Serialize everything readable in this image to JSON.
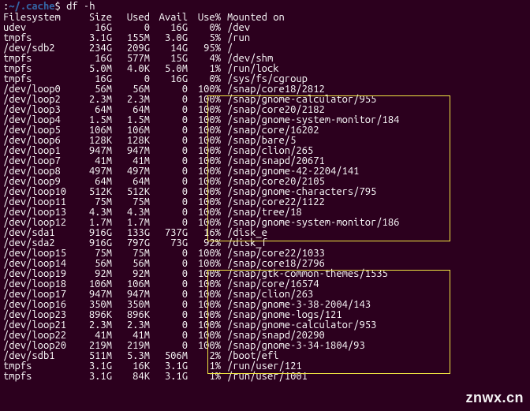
{
  "prompt": {
    "userhost_hidden": "",
    "path": "~/.cache",
    "symbol": "$",
    "command": "df -h"
  },
  "headers": {
    "filesystem": "Filesystem",
    "size": "Size",
    "used": "Used",
    "avail": "Avail",
    "use": "Use%",
    "mounted": "Mounted on"
  },
  "rows": [
    {
      "fs": "udev",
      "size": "16G",
      "used": "0",
      "avail": "16G",
      "use": "0%",
      "mnt": "/dev"
    },
    {
      "fs": "tmpfs",
      "size": "3.1G",
      "used": "155M",
      "avail": "3.0G",
      "use": "5%",
      "mnt": "/run"
    },
    {
      "fs": "/dev/sdb2",
      "size": "234G",
      "used": "209G",
      "avail": "14G",
      "use": "95%",
      "mnt": "/"
    },
    {
      "fs": "tmpfs",
      "size": "16G",
      "used": "577M",
      "avail": "15G",
      "use": "4%",
      "mnt": "/dev/shm"
    },
    {
      "fs": "tmpfs",
      "size": "5.0M",
      "used": "4.0K",
      "avail": "5.0M",
      "use": "1%",
      "mnt": "/run/lock"
    },
    {
      "fs": "tmpfs",
      "size": "16G",
      "used": "0",
      "avail": "16G",
      "use": "0%",
      "mnt": "/sys/fs/cgroup"
    },
    {
      "fs": "/dev/loop0",
      "size": "56M",
      "used": "56M",
      "avail": "0",
      "use": "100%",
      "mnt": "/snap/core18/2812"
    },
    {
      "fs": "/dev/loop2",
      "size": "2.3M",
      "used": "2.3M",
      "avail": "0",
      "use": "100%",
      "mnt": "/snap/gnome-calculator/955"
    },
    {
      "fs": "/dev/loop3",
      "size": "64M",
      "used": "64M",
      "avail": "0",
      "use": "100%",
      "mnt": "/snap/core20/2182"
    },
    {
      "fs": "/dev/loop4",
      "size": "1.5M",
      "used": "1.5M",
      "avail": "0",
      "use": "100%",
      "mnt": "/snap/gnome-system-monitor/184"
    },
    {
      "fs": "/dev/loop5",
      "size": "106M",
      "used": "106M",
      "avail": "0",
      "use": "100%",
      "mnt": "/snap/core/16202"
    },
    {
      "fs": "/dev/loop6",
      "size": "128K",
      "used": "128K",
      "avail": "0",
      "use": "100%",
      "mnt": "/snap/bare/5"
    },
    {
      "fs": "/dev/loop1",
      "size": "947M",
      "used": "947M",
      "avail": "0",
      "use": "100%",
      "mnt": "/snap/clion/265"
    },
    {
      "fs": "/dev/loop7",
      "size": "41M",
      "used": "41M",
      "avail": "0",
      "use": "100%",
      "mnt": "/snap/snapd/20671"
    },
    {
      "fs": "/dev/loop8",
      "size": "497M",
      "used": "497M",
      "avail": "0",
      "use": "100%",
      "mnt": "/snap/gnome-42-2204/141"
    },
    {
      "fs": "/dev/loop9",
      "size": "64M",
      "used": "64M",
      "avail": "0",
      "use": "100%",
      "mnt": "/snap/core20/2105"
    },
    {
      "fs": "/dev/loop10",
      "size": "512K",
      "used": "512K",
      "avail": "0",
      "use": "100%",
      "mnt": "/snap/gnome-characters/795"
    },
    {
      "fs": "/dev/loop11",
      "size": "75M",
      "used": "75M",
      "avail": "0",
      "use": "100%",
      "mnt": "/snap/core22/1122"
    },
    {
      "fs": "/dev/loop13",
      "size": "4.3M",
      "used": "4.3M",
      "avail": "0",
      "use": "100%",
      "mnt": "/snap/tree/18"
    },
    {
      "fs": "/dev/loop12",
      "size": "1.7M",
      "used": "1.7M",
      "avail": "0",
      "use": "100%",
      "mnt": "/snap/gnome-system-monitor/186"
    },
    {
      "fs": "/dev/sda1",
      "size": "916G",
      "used": "133G",
      "avail": "737G",
      "use": "16%",
      "mnt": "/disk_e"
    },
    {
      "fs": "/dev/sda2",
      "size": "916G",
      "used": "797G",
      "avail": "73G",
      "use": "92%",
      "mnt": "/disk_f"
    },
    {
      "fs": "/dev/loop15",
      "size": "75M",
      "used": "75M",
      "avail": "0",
      "use": "100%",
      "mnt": "/snap/core22/1033"
    },
    {
      "fs": "/dev/loop14",
      "size": "56M",
      "used": "56M",
      "avail": "0",
      "use": "100%",
      "mnt": "/snap/core18/2796"
    },
    {
      "fs": "/dev/loop19",
      "size": "92M",
      "used": "92M",
      "avail": "0",
      "use": "100%",
      "mnt": "/snap/gtk-common-themes/1535"
    },
    {
      "fs": "/dev/loop18",
      "size": "106M",
      "used": "106M",
      "avail": "0",
      "use": "100%",
      "mnt": "/snap/core/16574"
    },
    {
      "fs": "/dev/loop17",
      "size": "947M",
      "used": "947M",
      "avail": "0",
      "use": "100%",
      "mnt": "/snap/clion/263"
    },
    {
      "fs": "/dev/loop16",
      "size": "350M",
      "used": "350M",
      "avail": "0",
      "use": "100%",
      "mnt": "/snap/gnome-3-38-2004/143"
    },
    {
      "fs": "/dev/loop23",
      "size": "896K",
      "used": "896K",
      "avail": "0",
      "use": "100%",
      "mnt": "/snap/gnome-logs/121"
    },
    {
      "fs": "/dev/loop21",
      "size": "2.3M",
      "used": "2.3M",
      "avail": "0",
      "use": "100%",
      "mnt": "/snap/gnome-calculator/953"
    },
    {
      "fs": "/dev/loop22",
      "size": "41M",
      "used": "41M",
      "avail": "0",
      "use": "100%",
      "mnt": "/snap/snapd/20290"
    },
    {
      "fs": "/dev/loop20",
      "size": "219M",
      "used": "219M",
      "avail": "0",
      "use": "100%",
      "mnt": "/snap/gnome-3-34-1804/93"
    },
    {
      "fs": "/dev/sdb1",
      "size": "511M",
      "used": "5.3M",
      "avail": "506M",
      "use": "2%",
      "mnt": "/boot/efi"
    },
    {
      "fs": "tmpfs",
      "size": "3.1G",
      "used": "16K",
      "avail": "3.1G",
      "use": "1%",
      "mnt": "/run/user/121"
    },
    {
      "fs": "tmpfs",
      "size": "3.1G",
      "used": "84K",
      "avail": "3.1G",
      "use": "1%",
      "mnt": "/run/user/1001"
    }
  ],
  "watermark": "znwx.cn"
}
